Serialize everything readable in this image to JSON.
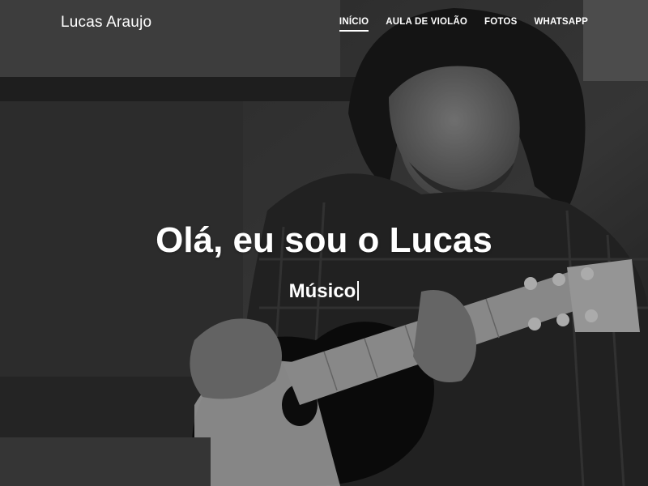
{
  "brand": "Lucas Araujo",
  "nav": {
    "items": [
      {
        "label": "INÍCIO",
        "active": true
      },
      {
        "label": "AULA DE VIOLÃO",
        "active": false
      },
      {
        "label": "FOTOS",
        "active": false
      },
      {
        "label": "WHATSAPP",
        "active": false
      }
    ]
  },
  "hero": {
    "headline": "Olá, eu sou o Lucas",
    "typed_text": "Músico",
    "background": "grayscale-photo-guitarist"
  },
  "colors": {
    "text": "#ffffff",
    "background": "#1f1f1f"
  }
}
